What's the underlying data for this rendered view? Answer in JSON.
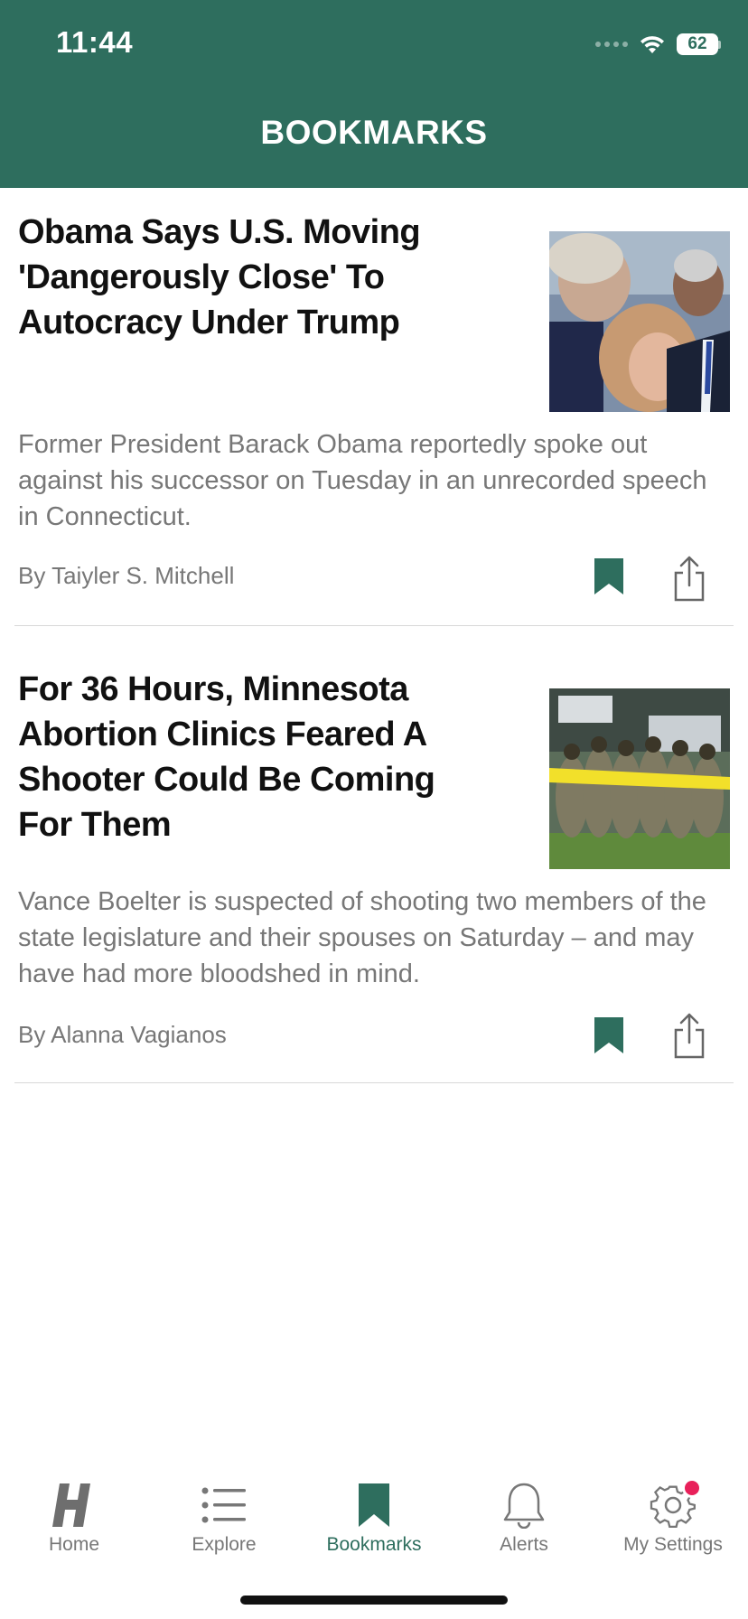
{
  "status_bar": {
    "time": "11:44",
    "battery": "62"
  },
  "header": {
    "title": "BOOKMARKS",
    "background_color": "#2e6e5e"
  },
  "articles": [
    {
      "title": "Obama Says U.S. Moving 'Dangerously Close' To Autocracy Under Trump",
      "summary": "Former President Barack Obama reportedly spoke out against his successor on Tuesday in an unrecorded speech in Connecticut.",
      "byline": "By Taiyler S. Mitchell",
      "bookmarked": true,
      "thumbnail": "photo-obama-crowd"
    },
    {
      "title": "For 36 Hours, Minnesota Abortion Clinics Feared A Shooter Could Be Coming For Them",
      "summary": "Vance Boelter is suspected of shooting two members of the state legislature and their spouses on Saturday – and may have had more bloodshed in mind.",
      "byline": "By Alanna Vagianos",
      "bookmarked": true,
      "thumbnail": "photo-police-tape-officers"
    }
  ],
  "tabbar": {
    "tabs": [
      {
        "label": "Home",
        "icon": "huffpost-h-icon",
        "active": false
      },
      {
        "label": "Explore",
        "icon": "list-icon",
        "active": false
      },
      {
        "label": "Bookmarks",
        "icon": "bookmark-icon",
        "active": true
      },
      {
        "label": "Alerts",
        "icon": "bell-icon",
        "active": false
      },
      {
        "label": "My Settings",
        "icon": "gear-icon",
        "active": false,
        "badge": true
      }
    ]
  },
  "colors": {
    "accent": "#2e6e5e",
    "badge": "#e8205a"
  }
}
